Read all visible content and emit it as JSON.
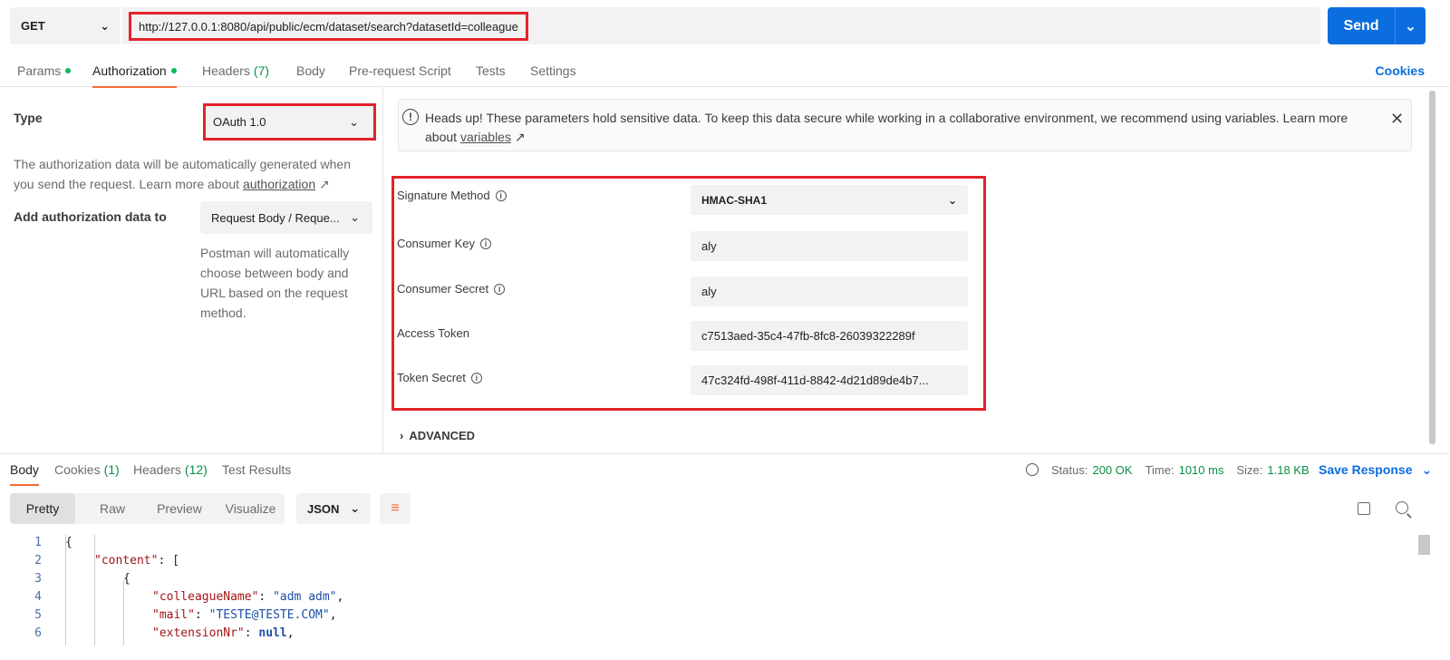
{
  "request": {
    "method": "GET",
    "url": "http://127.0.0.1:8080/api/public/ecm/dataset/search?datasetId=colleague",
    "send_label": "Send"
  },
  "req_tabs": [
    {
      "label": "Params",
      "dot": true
    },
    {
      "label": "Authorization",
      "dot": true
    },
    {
      "label": "Headers",
      "count": "(7)"
    },
    {
      "label": "Body"
    },
    {
      "label": "Pre-request Script"
    },
    {
      "label": "Tests"
    },
    {
      "label": "Settings"
    }
  ],
  "cookies_label": "Cookies",
  "auth": {
    "type_label": "Type",
    "type_value": "OAuth 1.0",
    "desc_prefix": "The authorization data will be automatically generated when you send the request. Learn more about ",
    "desc_link": "authorization",
    "add_label": "Add authorization data to",
    "add_value": "Request Body / Reque...",
    "add_help": "Postman will automatically choose between body and URL based on the request method."
  },
  "heads_up": {
    "text_prefix": "Heads up! These parameters hold sensitive data. To keep this data secure while working in a collaborative environment, we recommend using variables. Learn more about ",
    "link": "variables"
  },
  "params": [
    {
      "label": "Signature Method",
      "info": true,
      "value": "HMAC-SHA1",
      "select": true
    },
    {
      "label": "Consumer Key",
      "info": true,
      "value": "aly"
    },
    {
      "label": "Consumer Secret",
      "info": true,
      "value": "aly"
    },
    {
      "label": "Access Token",
      "info": false,
      "value": "c7513aed-35c4-47fb-8fc8-26039322289f"
    },
    {
      "label": "Token Secret",
      "info": true,
      "value": "47c324fd-498f-411d-8842-4d21d89de4b7..."
    }
  ],
  "advanced_label": "ADVANCED",
  "resp_tabs": [
    {
      "label": "Body"
    },
    {
      "label": "Cookies",
      "count": "(1)"
    },
    {
      "label": "Headers",
      "count": "(12)"
    },
    {
      "label": "Test Results"
    }
  ],
  "status": {
    "status_label": "Status:",
    "status_value": "200 OK",
    "time_label": "Time:",
    "time_value": "1010 ms",
    "size_label": "Size:",
    "size_value": "1.18 KB",
    "save_label": "Save Response"
  },
  "views": [
    "Pretty",
    "Raw",
    "Preview",
    "Visualize"
  ],
  "format": "JSON",
  "code_lines": [
    {
      "n": "1",
      "key": "",
      "punct": "{",
      "val": "",
      "vtype": ""
    },
    {
      "n": "2",
      "key": "\"content\"",
      "punct": ": [",
      "val": "",
      "vtype": ""
    },
    {
      "n": "3",
      "key": "",
      "punct": "{",
      "val": "",
      "vtype": ""
    },
    {
      "n": "4",
      "key": "\"colleagueName\"",
      "punct": ": ",
      "val": "\"adm adm\"",
      "vtype": "s",
      "trail": ","
    },
    {
      "n": "5",
      "key": "\"mail\"",
      "punct": ": ",
      "val": "\"TESTE@TESTE.COM\"",
      "vtype": "s",
      "trail": ","
    },
    {
      "n": "6",
      "key": "\"extensionNr\"",
      "punct": ": ",
      "val": "null",
      "vtype": "n",
      "trail": ","
    }
  ]
}
